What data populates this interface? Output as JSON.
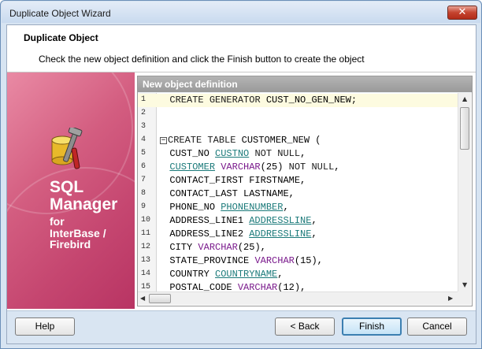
{
  "window": {
    "title": "Duplicate Object Wizard"
  },
  "header": {
    "title": "Duplicate Object",
    "subtitle": "Check the new object definition and click the Finish button to create the object"
  },
  "sidebar": {
    "product_line1": "SQL",
    "product_line2": "Manager",
    "product_line3": "for",
    "product_line4": "InterBase /",
    "product_line5": "Firebird"
  },
  "panel": {
    "caption": "New object definition"
  },
  "editor": {
    "lines": [
      {
        "n": "1",
        "text": "  CREATE GENERATOR CUST_NO_GEN_NEW;"
      },
      {
        "n": "2",
        "text": ""
      },
      {
        "n": "3",
        "text": ""
      },
      {
        "n": "4",
        "text": "CREATE TABLE CUSTOMER_NEW ("
      },
      {
        "n": "5",
        "text": "  CUST_NO CUSTNO NOT NULL,"
      },
      {
        "n": "6",
        "text": "  CUSTOMER VARCHAR(25) NOT NULL,"
      },
      {
        "n": "7",
        "text": "  CONTACT_FIRST FIRSTNAME,"
      },
      {
        "n": "8",
        "text": "  CONTACT_LAST LASTNAME,"
      },
      {
        "n": "9",
        "text": "  PHONE_NO PHONENUMBER,"
      },
      {
        "n": "10",
        "text": "  ADDRESS_LINE1 ADDRESSLINE,"
      },
      {
        "n": "11",
        "text": "  ADDRESS_LINE2 ADDRESSLINE,"
      },
      {
        "n": "12",
        "text": "  CITY VARCHAR(25),"
      },
      {
        "n": "13",
        "text": "  STATE_PROVINCE VARCHAR(15),"
      },
      {
        "n": "14",
        "text": "  COUNTRY COUNTRYNAME,"
      },
      {
        "n": "15",
        "text": "  POSTAL_CODE VARCHAR(12),"
      }
    ]
  },
  "footer": {
    "help_label": "Help",
    "back_label": "< Back",
    "finish_label": "Finish",
    "cancel_label": "Cancel"
  },
  "colors": {
    "sidebar_brand": "#c54670",
    "keyword": "#1a1a1a",
    "datatype": "#0a2fa0",
    "domain": "#1b7a7a",
    "type_name": "#7a1a8c"
  },
  "icons": [
    "close-icon",
    "database-tools-icon",
    "fold-minus-icon",
    "scroll-up-arrow-icon",
    "scroll-down-arrow-icon",
    "scroll-left-arrow-icon",
    "scroll-right-arrow-icon"
  ]
}
